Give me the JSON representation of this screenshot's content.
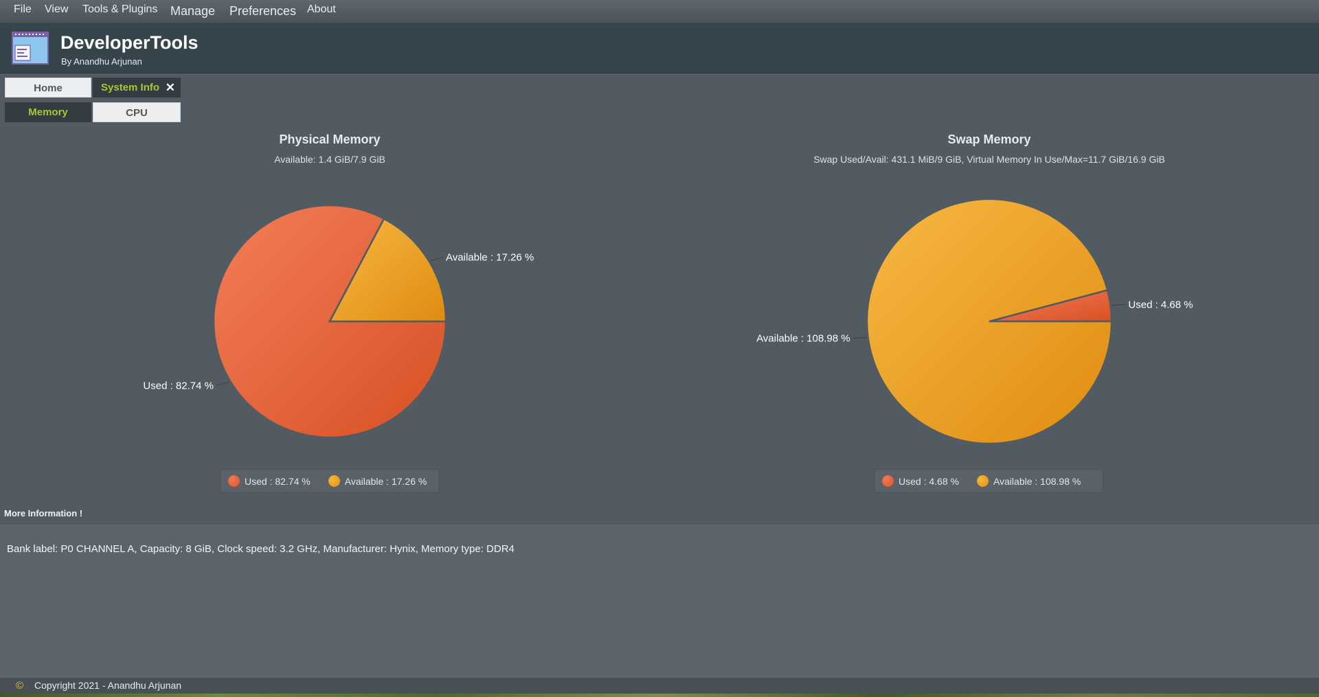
{
  "menu": {
    "file": "File",
    "view": "View",
    "tools": "Tools & Plugins",
    "manage": "Manage",
    "preferences": "Preferences",
    "about": "About"
  },
  "app": {
    "title": "DeveloperTools",
    "subtitle": "By Anandhu Arjunan",
    "icon": "app-window-icon"
  },
  "tabs": {
    "home": "Home",
    "system_info": "System Info",
    "close_glyph": "✕"
  },
  "subtabs": {
    "memory": "Memory",
    "cpu": "CPU"
  },
  "colors": {
    "used": "#e5623a",
    "available": "#eca02a",
    "accent": "#a5c935",
    "background": "#525a62"
  },
  "chart_data": [
    {
      "type": "pie",
      "title": "Physical Memory",
      "subtitle": "Available: 1.4 GiB/7.9 GiB",
      "slices": [
        {
          "name": "Used",
          "value": 82.74,
          "label": "Used : 82.74 %"
        },
        {
          "name": "Available",
          "value": 17.26,
          "label": "Available : 17.26 %"
        }
      ],
      "legend": [
        "Used : 82.74 %",
        "Available : 17.26 %"
      ],
      "legend_position": "bottom"
    },
    {
      "type": "pie",
      "title": "Swap Memory",
      "subtitle": "Swap Used/Avail: 431.1 MiB/9 GiB, Virtual Memory In Use/Max=11.7 GiB/16.9 GiB",
      "slices": [
        {
          "name": "Used",
          "value": 4.68,
          "label": "Used : 4.68 %"
        },
        {
          "name": "Available",
          "value": 108.98,
          "label": "Available : 108.98 %"
        }
      ],
      "legend": [
        "Used : 4.68 %",
        "Available : 108.98 %"
      ],
      "legend_position": "bottom"
    }
  ],
  "more_info": {
    "label": "More Information !",
    "text": "Bank label: P0 CHANNEL A, Capacity: 8 GiB, Clock speed: 3.2 GHz, Manufacturer: Hynix, Memory type: DDR4"
  },
  "status": {
    "copyright_glyph": "©",
    "copyright": "Copyright 2021 - Anandhu Arjunan"
  }
}
